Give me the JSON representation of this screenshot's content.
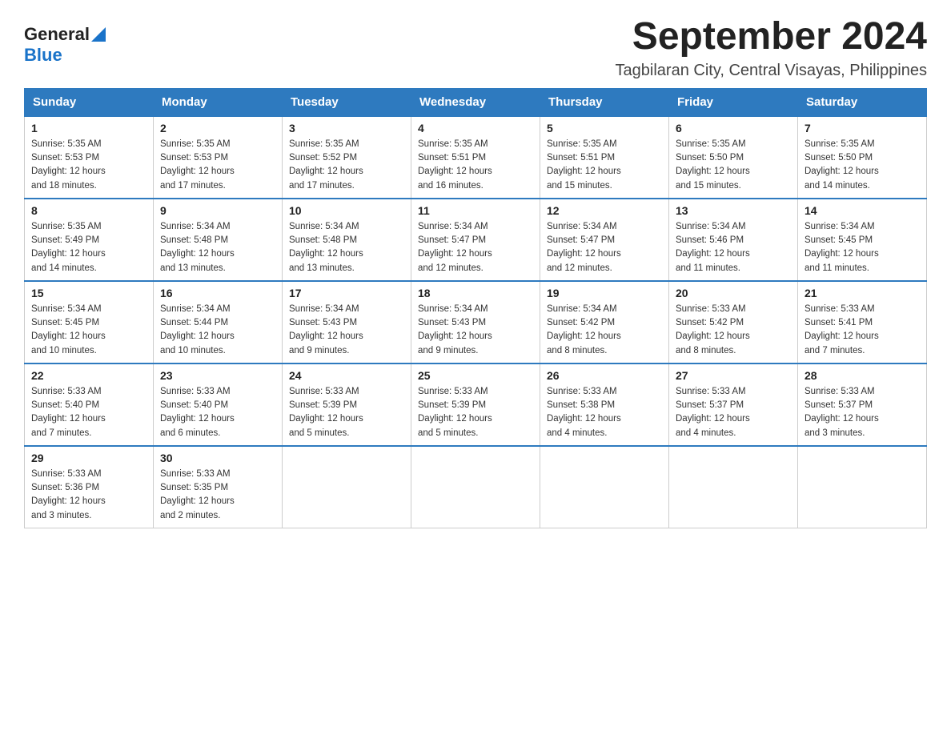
{
  "header": {
    "logo_general": "General",
    "logo_blue": "Blue",
    "month_title": "September 2024",
    "subtitle": "Tagbilaran City, Central Visayas, Philippines"
  },
  "weekdays": [
    "Sunday",
    "Monday",
    "Tuesday",
    "Wednesday",
    "Thursday",
    "Friday",
    "Saturday"
  ],
  "weeks": [
    [
      {
        "day": "1",
        "sunrise": "5:35 AM",
        "sunset": "5:53 PM",
        "daylight": "12 hours and 18 minutes."
      },
      {
        "day": "2",
        "sunrise": "5:35 AM",
        "sunset": "5:53 PM",
        "daylight": "12 hours and 17 minutes."
      },
      {
        "day": "3",
        "sunrise": "5:35 AM",
        "sunset": "5:52 PM",
        "daylight": "12 hours and 17 minutes."
      },
      {
        "day": "4",
        "sunrise": "5:35 AM",
        "sunset": "5:51 PM",
        "daylight": "12 hours and 16 minutes."
      },
      {
        "day": "5",
        "sunrise": "5:35 AM",
        "sunset": "5:51 PM",
        "daylight": "12 hours and 15 minutes."
      },
      {
        "day": "6",
        "sunrise": "5:35 AM",
        "sunset": "5:50 PM",
        "daylight": "12 hours and 15 minutes."
      },
      {
        "day": "7",
        "sunrise": "5:35 AM",
        "sunset": "5:50 PM",
        "daylight": "12 hours and 14 minutes."
      }
    ],
    [
      {
        "day": "8",
        "sunrise": "5:35 AM",
        "sunset": "5:49 PM",
        "daylight": "12 hours and 14 minutes."
      },
      {
        "day": "9",
        "sunrise": "5:34 AM",
        "sunset": "5:48 PM",
        "daylight": "12 hours and 13 minutes."
      },
      {
        "day": "10",
        "sunrise": "5:34 AM",
        "sunset": "5:48 PM",
        "daylight": "12 hours and 13 minutes."
      },
      {
        "day": "11",
        "sunrise": "5:34 AM",
        "sunset": "5:47 PM",
        "daylight": "12 hours and 12 minutes."
      },
      {
        "day": "12",
        "sunrise": "5:34 AM",
        "sunset": "5:47 PM",
        "daylight": "12 hours and 12 minutes."
      },
      {
        "day": "13",
        "sunrise": "5:34 AM",
        "sunset": "5:46 PM",
        "daylight": "12 hours and 11 minutes."
      },
      {
        "day": "14",
        "sunrise": "5:34 AM",
        "sunset": "5:45 PM",
        "daylight": "12 hours and 11 minutes."
      }
    ],
    [
      {
        "day": "15",
        "sunrise": "5:34 AM",
        "sunset": "5:45 PM",
        "daylight": "12 hours and 10 minutes."
      },
      {
        "day": "16",
        "sunrise": "5:34 AM",
        "sunset": "5:44 PM",
        "daylight": "12 hours and 10 minutes."
      },
      {
        "day": "17",
        "sunrise": "5:34 AM",
        "sunset": "5:43 PM",
        "daylight": "12 hours and 9 minutes."
      },
      {
        "day": "18",
        "sunrise": "5:34 AM",
        "sunset": "5:43 PM",
        "daylight": "12 hours and 9 minutes."
      },
      {
        "day": "19",
        "sunrise": "5:34 AM",
        "sunset": "5:42 PM",
        "daylight": "12 hours and 8 minutes."
      },
      {
        "day": "20",
        "sunrise": "5:33 AM",
        "sunset": "5:42 PM",
        "daylight": "12 hours and 8 minutes."
      },
      {
        "day": "21",
        "sunrise": "5:33 AM",
        "sunset": "5:41 PM",
        "daylight": "12 hours and 7 minutes."
      }
    ],
    [
      {
        "day": "22",
        "sunrise": "5:33 AM",
        "sunset": "5:40 PM",
        "daylight": "12 hours and 7 minutes."
      },
      {
        "day": "23",
        "sunrise": "5:33 AM",
        "sunset": "5:40 PM",
        "daylight": "12 hours and 6 minutes."
      },
      {
        "day": "24",
        "sunrise": "5:33 AM",
        "sunset": "5:39 PM",
        "daylight": "12 hours and 5 minutes."
      },
      {
        "day": "25",
        "sunrise": "5:33 AM",
        "sunset": "5:39 PM",
        "daylight": "12 hours and 5 minutes."
      },
      {
        "day": "26",
        "sunrise": "5:33 AM",
        "sunset": "5:38 PM",
        "daylight": "12 hours and 4 minutes."
      },
      {
        "day": "27",
        "sunrise": "5:33 AM",
        "sunset": "5:37 PM",
        "daylight": "12 hours and 4 minutes."
      },
      {
        "day": "28",
        "sunrise": "5:33 AM",
        "sunset": "5:37 PM",
        "daylight": "12 hours and 3 minutes."
      }
    ],
    [
      {
        "day": "29",
        "sunrise": "5:33 AM",
        "sunset": "5:36 PM",
        "daylight": "12 hours and 3 minutes."
      },
      {
        "day": "30",
        "sunrise": "5:33 AM",
        "sunset": "5:35 PM",
        "daylight": "12 hours and 2 minutes."
      },
      null,
      null,
      null,
      null,
      null
    ]
  ],
  "labels": {
    "sunrise": "Sunrise:",
    "sunset": "Sunset:",
    "daylight": "Daylight:"
  }
}
